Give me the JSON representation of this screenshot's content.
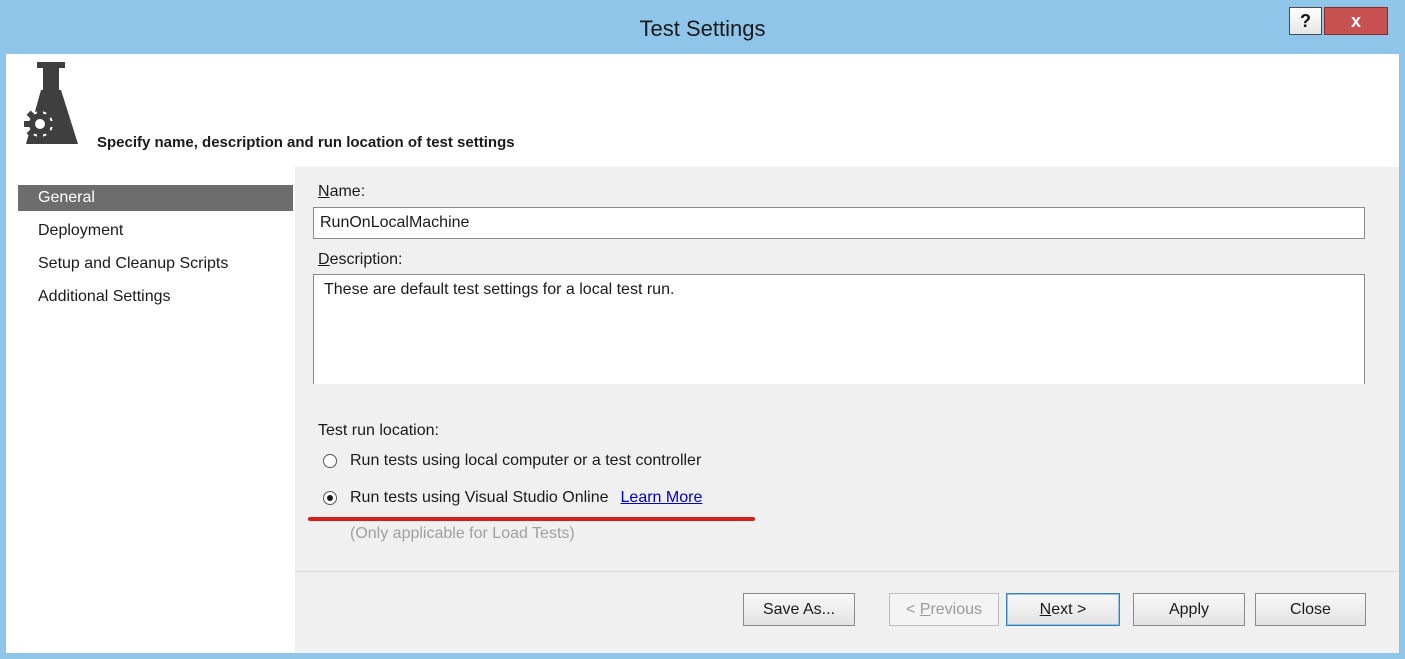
{
  "window": {
    "title": "Test Settings",
    "help_label": "?",
    "close_label": "x"
  },
  "header": {
    "heading": "Specify name, description and run location of test settings",
    "icon": "flask-gear-icon"
  },
  "sidebar": {
    "items": [
      {
        "label": "General",
        "selected": true
      },
      {
        "label": "Deployment",
        "selected": false
      },
      {
        "label": "Setup and Cleanup Scripts",
        "selected": false
      },
      {
        "label": "Additional Settings",
        "selected": false
      }
    ]
  },
  "form": {
    "name_label_accel": "N",
    "name_label_rest": "ame:",
    "name_value": "RunOnLocalMachine",
    "description_label_accel": "D",
    "description_label_rest": "escription:",
    "description_value": "These are default test settings for a local test run.",
    "run_location_label": "Test run location:",
    "option_local": "Run tests using local computer or a test controller",
    "option_online": "Run tests using Visual Studio Online",
    "selected_option": "option_online",
    "learn_more": "Learn More",
    "note": "(Only applicable for Load Tests)"
  },
  "buttons": {
    "save_as": "Save As...",
    "previous_prefix": "< ",
    "previous_accel": "P",
    "previous_rest": "revious",
    "next_accel": "N",
    "next_rest": "ext >",
    "apply": "Apply",
    "close": "Close"
  },
  "colors": {
    "titlebar": "#8fc5e8",
    "selected_item": "#6d6d6d",
    "link": "#0000cc",
    "annotation_underline": "#d61d1d"
  }
}
